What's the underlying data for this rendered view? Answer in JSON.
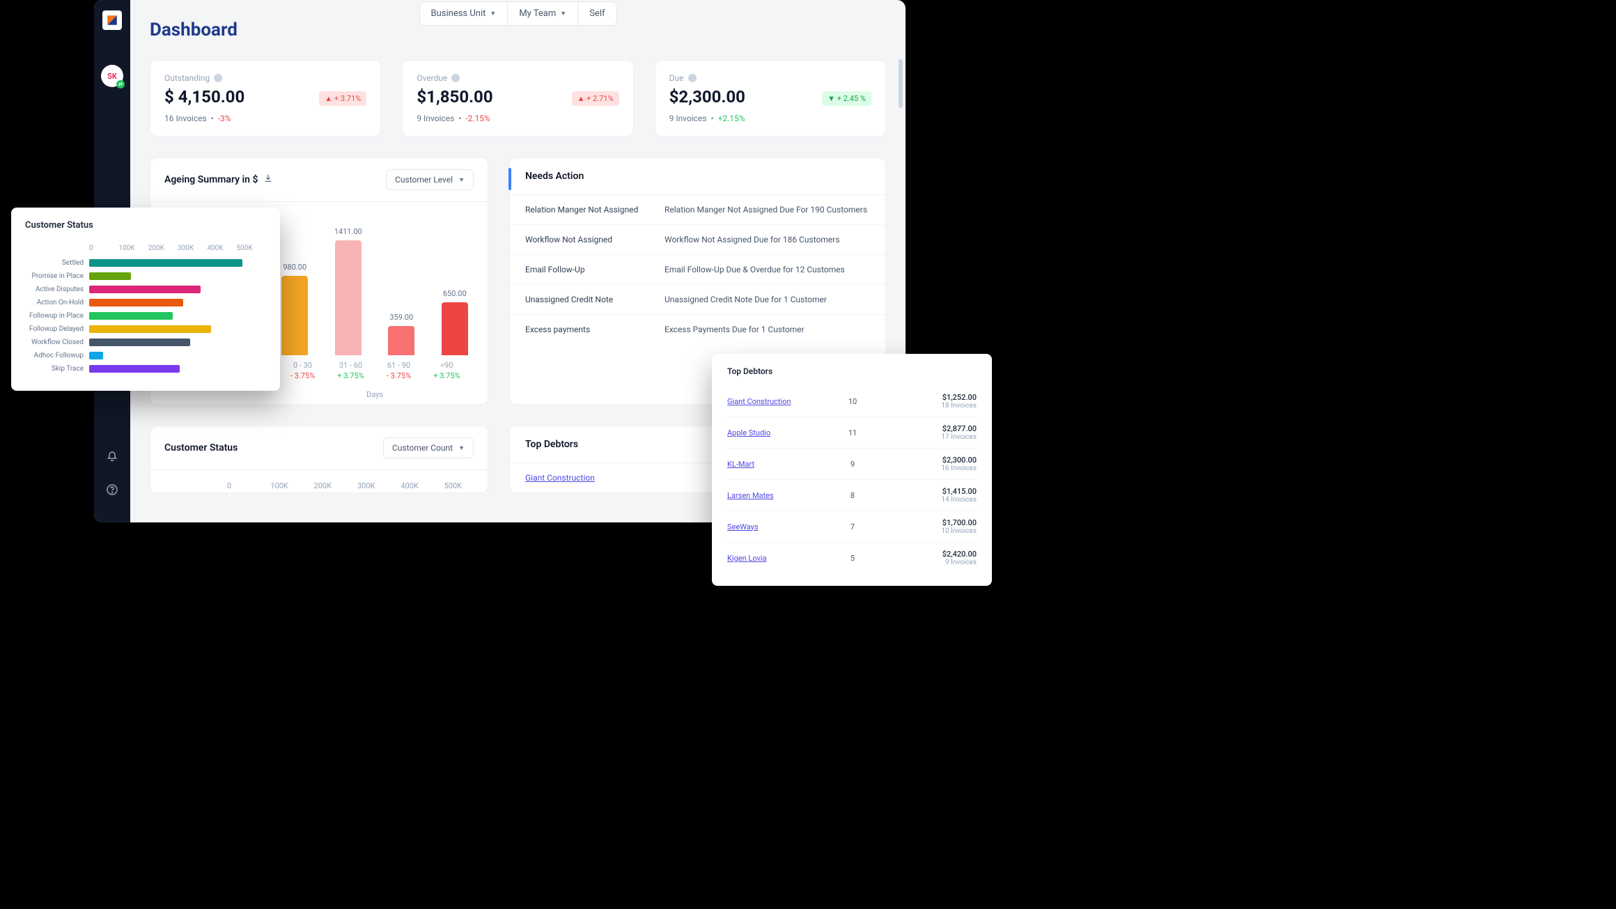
{
  "tabs": [
    "Business Unit",
    "My Team",
    "Self"
  ],
  "avatar": "SK",
  "title": "Dashboard",
  "cards": [
    {
      "label": "Outstanding",
      "amount": "$ 4,150.00",
      "invoices": "16 Invoices",
      "delta": "-3%",
      "deltaClass": "neg",
      "badge": "+ 3.71%",
      "badgeDir": "up"
    },
    {
      "label": "Overdue",
      "amount": "$1,850.00",
      "invoices": "9 Invoices",
      "delta": "-2.15%",
      "deltaClass": "neg",
      "badge": "+ 2.71%",
      "badgeDir": "up"
    },
    {
      "label": "Due",
      "amount": "$2,300.00",
      "invoices": "9 Invoices",
      "delta": "+2.15%",
      "deltaClass": "pos",
      "badge": "+ 2.45 %",
      "badgeDir": "down"
    }
  ],
  "ageing": {
    "title": "Ageing Summary in $",
    "select": "Customer Level",
    "xlabel": "Days"
  },
  "needs": {
    "title": "Needs Action",
    "items": [
      {
        "l": "Relation Manger Not Assigned",
        "r": "Relation Manger Not Assigned Due For 190 Customers"
      },
      {
        "l": "Workflow Not Assigned",
        "r": "Workflow Not Assigned Due for 186 Customers"
      },
      {
        "l": "Email Follow-Up",
        "r": "Email Follow-Up Due & Overdue for 12 Customes"
      },
      {
        "l": "Unassigned Credit Note",
        "r": "Unassigned Credit Note Due for 1 Customer"
      },
      {
        "l": "Excess payments",
        "r": "Excess Payments Due for 1 Customer"
      }
    ]
  },
  "custStatus": {
    "title": "Customer Status",
    "select": "Customer Count",
    "ticks": [
      "0",
      "100K",
      "200K",
      "300K",
      "400K",
      "500K"
    ]
  },
  "topDebtors": {
    "title": "Top Debtors",
    "row": {
      "name": "Giant Construction",
      "cnt": "10"
    }
  },
  "floatCS": {
    "title": "Customer Status",
    "ticks": [
      "0",
      "100K",
      "200K",
      "300K",
      "400K",
      "500K"
    ]
  },
  "floatTD": {
    "title": "Top Debtors",
    "rows": [
      {
        "name": "Giant Construction",
        "cnt": "10",
        "amt": "$1,252.00",
        "inv": "18 Invoices"
      },
      {
        "name": "Apple Studio",
        "cnt": "11",
        "amt": "$2,877.00",
        "inv": "17 Invoices"
      },
      {
        "name": "KL-Mart",
        "cnt": "9",
        "amt": "$2,300.00",
        "inv": "16 Invoices"
      },
      {
        "name": "Larsen Mates",
        "cnt": "8",
        "amt": "$1,415.00",
        "inv": "14 Invoices"
      },
      {
        "name": "SeeWays",
        "cnt": "7",
        "amt": "$1,700.00",
        "inv": "10 Invoices"
      },
      {
        "name": "Kigen Lovia",
        "cnt": "5",
        "amt": "$2,420.00",
        "inv": "9 Invoices"
      }
    ]
  },
  "chart_data": [
    {
      "type": "bar",
      "title": "Ageing Summary in $",
      "xlabel": "Days",
      "ylabel": "$",
      "ylim": [
        0,
        1500
      ],
      "categories": [
        "0 - 30",
        "31 - 60",
        "61 - 90",
        "<90"
      ],
      "values": [
        980,
        1411,
        359,
        650
      ],
      "colors": [
        "#f5a623",
        "#f8b4b4",
        "#f87171",
        "#ef4444"
      ],
      "pct": [
        "- 3.75%",
        "+ 3.75%",
        "- 3.75%",
        "+ 3.75%"
      ],
      "pctClass": [
        "neg",
        "pos",
        "neg",
        "pos"
      ]
    },
    {
      "type": "bar",
      "title": "Customer Status",
      "orientation": "horizontal",
      "xlim": [
        0,
        500000
      ],
      "categories": [
        "Settled",
        "Promise in Place",
        "Active Disputes",
        "Action On-Hold",
        "Followup in Place",
        "Followup Delayed",
        "Workflow Closed",
        "Adhoc Followup",
        "Skip Trace"
      ],
      "values": [
        440000,
        120000,
        320000,
        270000,
        240000,
        350000,
        290000,
        40000,
        260000
      ],
      "colors": [
        "#0d9488",
        "#65a30d",
        "#db2777",
        "#ea580c",
        "#22c55e",
        "#eab308",
        "#475569",
        "#0ea5e9",
        "#7c3aed"
      ]
    }
  ]
}
